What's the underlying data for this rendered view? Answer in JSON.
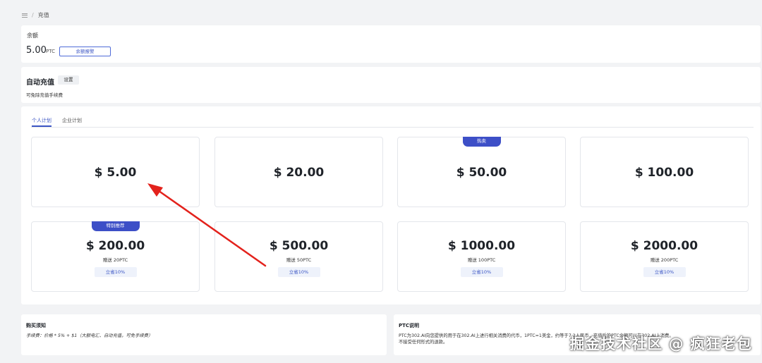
{
  "breadcrumb": {
    "current": "充值"
  },
  "balance": {
    "label": "余额",
    "amount": "5.00",
    "unit": "PTC",
    "alert_button": "余额报警"
  },
  "auto_recharge": {
    "title": "自动充值",
    "settings_button": "设置",
    "description": "可免除充值手续费"
  },
  "tabs": [
    {
      "label": "个人计划",
      "active": true
    },
    {
      "label": "企业计划",
      "active": false
    }
  ],
  "plans": [
    {
      "price": "$ 5.00"
    },
    {
      "price": "$ 20.00"
    },
    {
      "price": "$ 50.00",
      "badge": "热卖"
    },
    {
      "price": "$ 100.00"
    },
    {
      "price": "$ 200.00",
      "badge": "特别推荐",
      "bonus": "赠送 20PTC",
      "save": "立省10%"
    },
    {
      "price": "$ 500.00",
      "bonus": "赠送 50PTC",
      "save": "立省10%"
    },
    {
      "price": "$ 1000.00",
      "bonus": "赠送 100PTC",
      "save": "立省10%"
    },
    {
      "price": "$ 2000.00",
      "bonus": "赠送 200PTC",
      "save": "立省10%"
    }
  ],
  "purchase_notice": {
    "title": "购买须知",
    "text": "手续费：价格 * 5% + $1（大额电汇、自动充值，可免手续费）"
  },
  "ptc_info": {
    "title": "PTC说明",
    "text_line1": "PTC为302.AI向您提供的用于在302.AI上进行相关消费的代币，1PTC=1美金，约等于7.2人民币，充值后的PTC余额可以在302.AI上消费。",
    "text_line2": "不接受任何形式的退款。"
  },
  "watermark": "掘金技术社区 @ 疯狂老包",
  "colors": {
    "accent": "#3d4fc7",
    "annotation_arrow": "#e3221c"
  }
}
